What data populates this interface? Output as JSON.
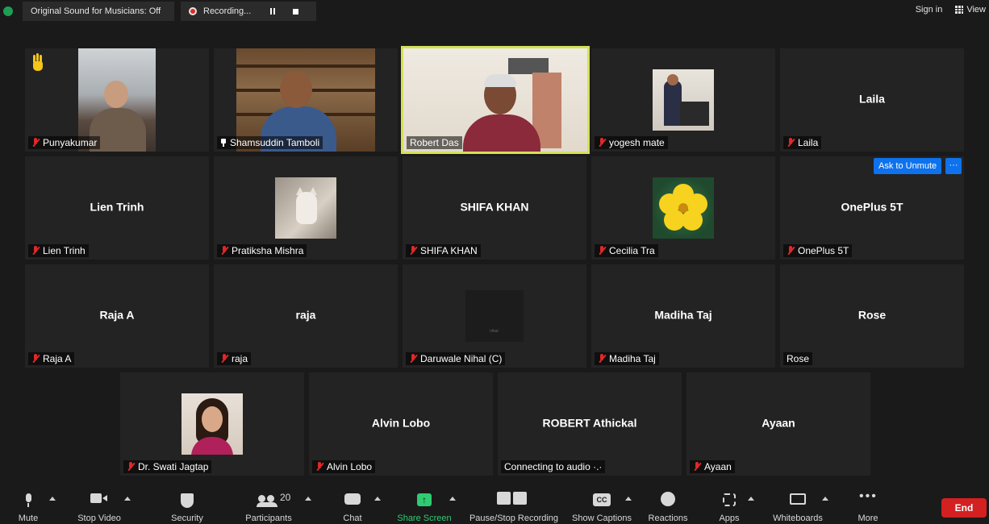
{
  "topbar": {
    "original_sound": "Original Sound for Musicians: Off",
    "recording": "Recording...",
    "sign_in": "Sign in",
    "view": "View"
  },
  "tiles": {
    "punyakumar": {
      "label": "Punyakumar"
    },
    "shamsuddin": {
      "label": "Shamsuddin Tamboli"
    },
    "robert_das": {
      "label": "Robert Das"
    },
    "yogesh": {
      "label": "yogesh mate"
    },
    "laila": {
      "center": "Laila",
      "label": "Laila"
    },
    "lien": {
      "center": "Lien Trinh",
      "label": "Lien Trinh"
    },
    "pratiksha": {
      "label": "Pratiksha Mishra"
    },
    "shifa": {
      "center": "SHIFA KHAN",
      "label": "SHIFA KHAN"
    },
    "cecilia": {
      "label": "Cecilia Tra"
    },
    "oneplus": {
      "center": "OnePlus 5T",
      "label": "OnePlus 5T",
      "ask_unmute": "Ask to Unmute",
      "more": "···"
    },
    "raja_a": {
      "center": "Raja A",
      "label": "Raja A"
    },
    "raja": {
      "center": "raja",
      "label": "raja"
    },
    "nihal": {
      "label": "Daruwale Nihal (C)",
      "thumb_text": "nihal"
    },
    "madiha": {
      "center": "Madiha Taj",
      "label": "Madiha Taj"
    },
    "rose": {
      "center": "Rose",
      "label": "Rose"
    },
    "swati": {
      "label": "Dr. Swati Jagtap"
    },
    "alvin": {
      "center": "Alvin Lobo",
      "label": "Alvin Lobo"
    },
    "robert_a": {
      "center": "ROBERT Athickal",
      "label": "Connecting to audio ·.·"
    },
    "ayaan": {
      "center": "Ayaan",
      "label": "Ayaan"
    }
  },
  "toolbar": {
    "mute": "Mute",
    "stop_video": "Stop Video",
    "security": "Security",
    "participants": "Participants",
    "participants_count": "20",
    "chat": "Chat",
    "share_screen": "Share Screen",
    "share_arrow": "↑",
    "pause_recording": "Pause/Stop Recording",
    "show_captions": "Show Captions",
    "cc": "CC",
    "reactions": "Reactions",
    "apps": "Apps",
    "whiteboards": "Whiteboards",
    "more": "More",
    "end": "End"
  },
  "colors": {
    "accent_blue": "#0e72ed",
    "end_red": "#d32020",
    "share_green": "#2ecc71",
    "active_speaker": "#d4e157",
    "muted_red": "#e02828"
  }
}
